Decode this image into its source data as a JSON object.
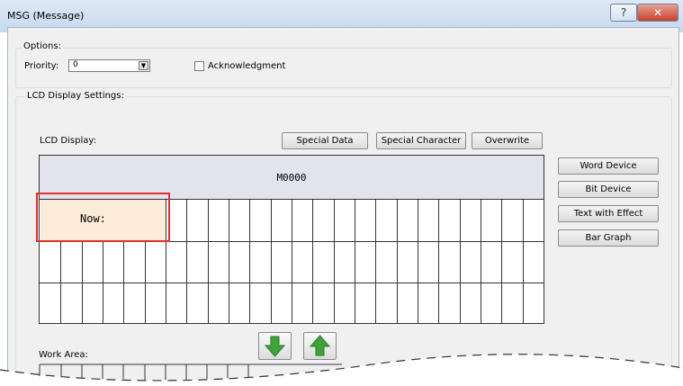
{
  "window": {
    "title": "MSG (Message)",
    "help_label": "?",
    "close_label": "✕"
  },
  "options": {
    "group_label": "Options:",
    "priority_label": "Priority:",
    "priority_value": "0",
    "acknowledgment_label": "Acknowledgment",
    "acknowledgment_checked": false
  },
  "lcd_settings": {
    "group_label": "LCD Display Settings:",
    "lcd_display_label": "LCD Display:",
    "buttons": {
      "special_data": "Special Data",
      "special_character": "Special Character",
      "overwrite": "Overwrite"
    },
    "header_text": "M0000",
    "cell_text": "Now:",
    "side_buttons": {
      "word_device": "Word Device",
      "bit_device": "Bit Device",
      "text_with_effect": "Text with Effect",
      "bar_graph": "Bar Graph"
    },
    "work_area_label": "Work Area:"
  },
  "icons": {
    "move_down": "down-arrow-icon",
    "move_up": "up-arrow-icon",
    "help": "question-icon",
    "close": "close-icon",
    "dropdown": "chevron-down-icon"
  },
  "colors": {
    "highlight": "#e0302a",
    "arrow_green": "#3ea33a",
    "lcd_header": "#e3e3f0",
    "cell_fill": "#fcebd8"
  }
}
